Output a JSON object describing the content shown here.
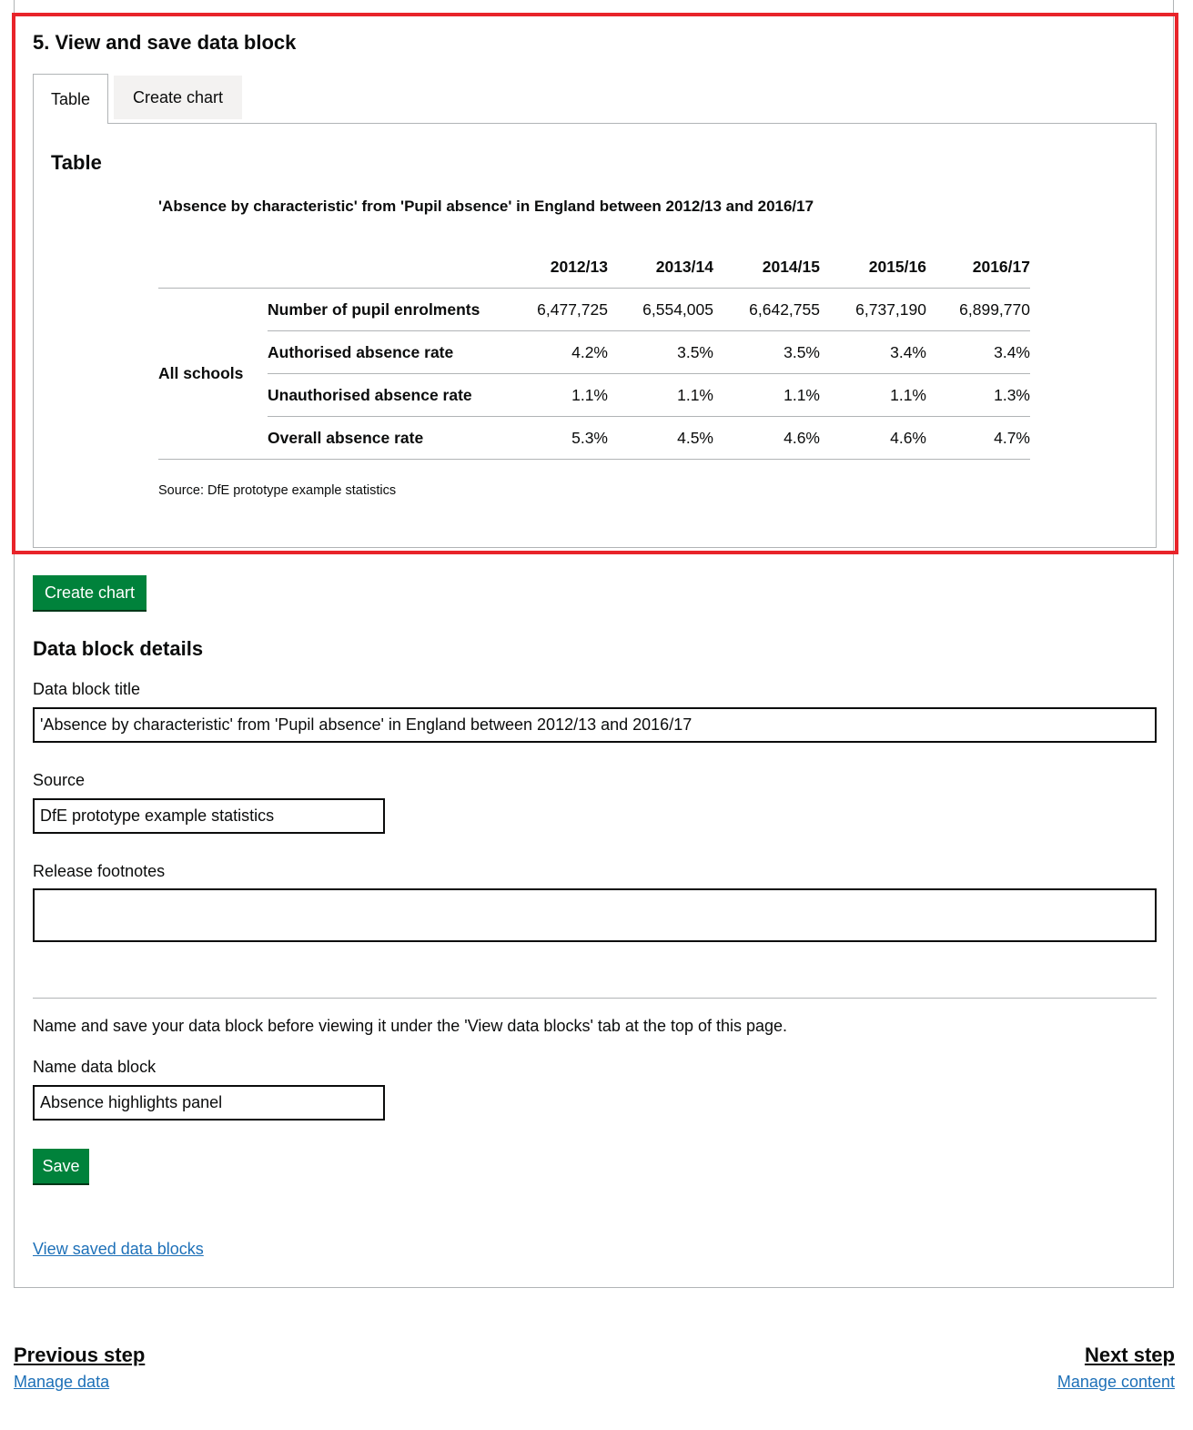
{
  "step": {
    "title": "5. View and save data block"
  },
  "tabs": {
    "table_label": "Table",
    "chart_label": "Create chart"
  },
  "table_panel": {
    "title": "Table",
    "caption": "'Absence by characteristic' from 'Pupil absence' in England between 2012/13 and 2016/17",
    "group_label": "All schools",
    "columns": [
      "2012/13",
      "2013/14",
      "2014/15",
      "2015/16",
      "2016/17"
    ],
    "rows": [
      {
        "label": "Number of pupil enrolments",
        "values": [
          "6,477,725",
          "6,554,005",
          "6,642,755",
          "6,737,190",
          "6,899,770"
        ]
      },
      {
        "label": "Authorised absence rate",
        "values": [
          "4.2%",
          "3.5%",
          "3.5%",
          "3.4%",
          "3.4%"
        ]
      },
      {
        "label": "Unauthorised absence rate",
        "values": [
          "1.1%",
          "1.1%",
          "1.1%",
          "1.1%",
          "1.3%"
        ]
      },
      {
        "label": "Overall absence rate",
        "values": [
          "5.3%",
          "4.5%",
          "4.6%",
          "4.6%",
          "4.7%"
        ]
      }
    ],
    "source": "Source: DfE prototype example statistics"
  },
  "create_chart_button": "Create chart",
  "details": {
    "heading": "Data block details",
    "title_label": "Data block title",
    "title_value": "'Absence by characteristic' from 'Pupil absence' in England between 2012/13 and 2016/17",
    "source_label": "Source",
    "source_value": "DfE prototype example statistics",
    "footnotes_label": "Release footnotes",
    "footnotes_value": ""
  },
  "save_section": {
    "note": "Name and save your data block before viewing it under the 'View data blocks' tab at the top of this page.",
    "name_label": "Name data block",
    "name_value": "Absence highlights panel",
    "save_button": "Save",
    "view_saved_link": "View saved data blocks"
  },
  "pagination": {
    "previous_title": "Previous step",
    "previous_link": "Manage data",
    "next_title": "Next step",
    "next_link": "Manage content"
  },
  "colors": {
    "button": "#00823b",
    "link": "#1d70b8",
    "highlight": "#e8242a"
  }
}
